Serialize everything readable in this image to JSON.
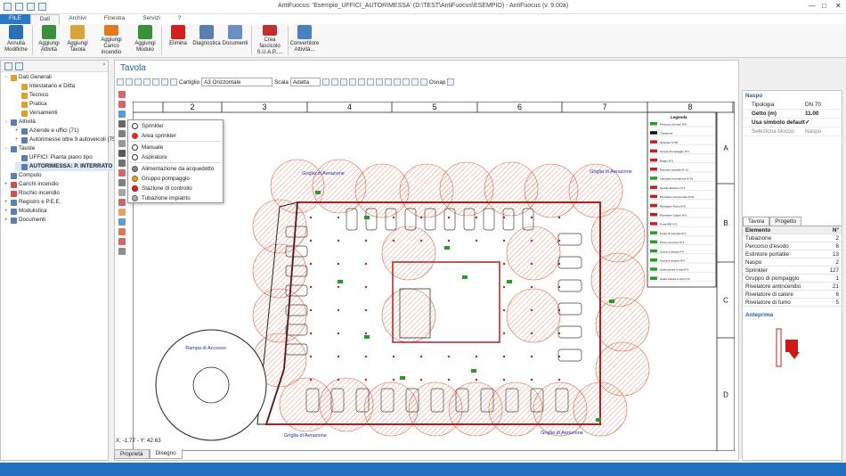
{
  "app": {
    "title": "AntiFuocus: 'Esempio_UFFICI_AUTORIMESSA' (D:\\TEST\\AntiFuocus\\ESEMPIO) - AntiFuocus (v. 9.00a)"
  },
  "menu": [
    "FILE",
    "Dati",
    "Archivi",
    "Finestra",
    "Servizi",
    "?"
  ],
  "ribbon": [
    {
      "label": "Annulla Modifiche",
      "color": "#2b6fb5"
    },
    {
      "label": "Aggiungi Attività",
      "color": "#3a8f3a"
    },
    {
      "label": "Aggiungi Tavola",
      "color": "#d9a53a"
    },
    {
      "label": "Aggiungi Carico incendio",
      "color": "#e07a20"
    },
    {
      "label": "Aggiungi Modulo",
      "color": "#3a8f3a"
    },
    {
      "label": "Elimina",
      "color": "#d02020"
    },
    {
      "label": "Diagnostica",
      "color": "#5a7fb0"
    },
    {
      "label": "Documenti",
      "color": "#6a8fc0"
    },
    {
      "label": "Crea fascicolo S.U.A.P.....",
      "color": "#c03030"
    },
    {
      "label": "Convertitore Attività...",
      "color": "#4a7fc0"
    }
  ],
  "tree": [
    {
      "t": "Dati Generali",
      "lvl": 0,
      "tw": "−",
      "c": "#e0a030"
    },
    {
      "t": "Intestatario e Ditta",
      "lvl": 1,
      "c": "#e0a030"
    },
    {
      "t": "Tecnico",
      "lvl": 1,
      "c": "#e0a030"
    },
    {
      "t": "Pratica",
      "lvl": 1,
      "c": "#e0a030"
    },
    {
      "t": "Versamenti",
      "lvl": 1,
      "c": "#e0a030"
    },
    {
      "t": "Attività",
      "lvl": 0,
      "tw": "−",
      "c": "#5a7fb0"
    },
    {
      "t": "Aziende e uffici (71)",
      "lvl": 1,
      "tw": "+",
      "c": "#5a7fb0"
    },
    {
      "t": "Autorimesse oltre 9 autoveicoli (75)",
      "lvl": 1,
      "tw": "+",
      "c": "#5a7fb0"
    },
    {
      "t": "Tavole",
      "lvl": 0,
      "tw": "−",
      "c": "#5a7fb0"
    },
    {
      "t": "UFFICI: Pianta piano tipo",
      "lvl": 1,
      "c": "#5a7fb0"
    },
    {
      "t": "AUTORIMESSA: P. INTERRATO",
      "lvl": 1,
      "c": "#5a7fb0",
      "b": true
    },
    {
      "t": "Computo",
      "lvl": 0,
      "c": "#5a7fb0"
    },
    {
      "t": "Carichi incendio",
      "lvl": 0,
      "tw": "+",
      "c": "#d05050"
    },
    {
      "t": "Rischio incendio",
      "lvl": 0,
      "c": "#d05050"
    },
    {
      "t": "Registro e P.E.E.",
      "lvl": 0,
      "tw": "+",
      "c": "#5a7fb0"
    },
    {
      "t": "Modulistica",
      "lvl": 0,
      "tw": "+",
      "c": "#5a7fb0"
    },
    {
      "t": "Documenti",
      "lvl": 0,
      "tw": "+",
      "c": "#5a7fb0"
    }
  ],
  "tavola": {
    "title": "Tavola",
    "cartiglio_label": "Cartiglio",
    "cartiglio_value": "A3 Orizzontale",
    "scala_label": "Scala",
    "scala_value": "Adatta",
    "osnap": "Osnap"
  },
  "context_menu": [
    {
      "label": "Sprinkler",
      "c": "#fff",
      "b": "#333"
    },
    {
      "label": "Area sprinkler",
      "c": "#d03030",
      "b": "#d03030"
    },
    {
      "sep": true
    },
    {
      "label": "Manuale",
      "c": "#fff",
      "b": "#333"
    },
    {
      "label": "Aspiratore",
      "c": "#fff",
      "b": "#333"
    },
    {
      "sep": true
    },
    {
      "label": "Alimentazione da acquedotto",
      "c": "#888",
      "b": "#555"
    },
    {
      "label": "Gruppo pompaggio",
      "c": "#e0a030",
      "b": "#a06010"
    },
    {
      "label": "Stazione di controllo",
      "c": "#d03030",
      "b": "#a00"
    },
    {
      "label": "Tubazione impianto",
      "c": "#aaa",
      "b": "#666"
    }
  ],
  "drawing": {
    "columns": [
      "2",
      "3",
      "4",
      "5",
      "6",
      "7",
      "8"
    ],
    "rows": [
      "A",
      "B",
      "C",
      "D"
    ],
    "grilles": [
      "Griglia di Aerazione",
      "Griglia di Aerazione",
      "Griglia di Aerazione",
      "Griglia di Aerazione"
    ],
    "ramp": "Rampa di Accesso",
    "legend_title": "Legenda",
    "legend": [
      "Percorso d'esodo N°6",
      "Tubazione",
      "Sprinkler N°18",
      "Gruppo Pompaggio N°1",
      "Naspo N°2",
      "Estintore portatile N°13",
      "Lampada emergenza N°15",
      "Quadro Elettrico N°1",
      "Rivelatore Antincendio N°21",
      "Rivelatore Fumo N°5",
      "Rivelatore Calore N°6",
      "Porta REI N°2",
      "Punto di raccolta N°1",
      "Primo soccorso N°1",
      "Uscita a destra N°4",
      "Uscita a sinistra N°4",
      "Scala destra in alto N°2",
      "Scala sinistra in alto N°2"
    ]
  },
  "coords": "X: -1.77 - Y: 42.63",
  "bottom_tabs": [
    "Proprietà",
    "Disegno"
  ],
  "naspo": {
    "title": "Naspo",
    "props": [
      {
        "k": "Tipologia",
        "v": "DN 70"
      },
      {
        "k": "Getto (m)",
        "v": "11.00"
      },
      {
        "k": "Usa simbolo default",
        "v": "✓"
      },
      {
        "k": "Seleziona blocco",
        "v": "Naspo"
      }
    ]
  },
  "tavola_tabs": [
    "Tavola",
    "Progetto"
  ],
  "elements_header": {
    "n": "Elemento",
    "c": "N°"
  },
  "elements": [
    {
      "n": "Tubazione",
      "c": "2"
    },
    {
      "n": "Percorso d'esodo",
      "c": "6"
    },
    {
      "n": "Estintore portatile",
      "c": "13"
    },
    {
      "n": "Naspo",
      "c": "2"
    },
    {
      "n": "Sprinkler",
      "c": "127"
    },
    {
      "n": "Gruppo di pompaggio",
      "c": "1"
    },
    {
      "n": "Rivelatore antincendio",
      "c": "21"
    },
    {
      "n": "Rivelatore di calore",
      "c": "6"
    },
    {
      "n": "Rivelatore di fumo",
      "c": "5"
    }
  ],
  "anteprima": "Anteprima"
}
